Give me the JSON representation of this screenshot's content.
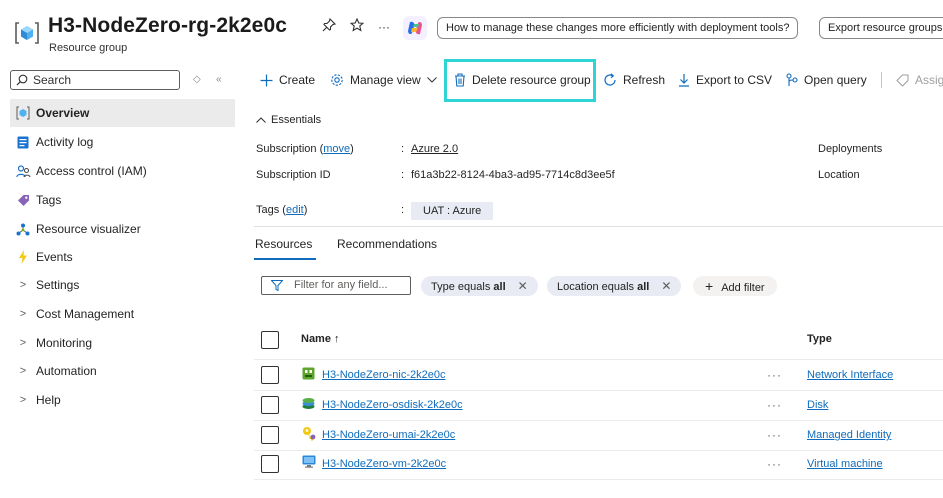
{
  "header": {
    "title": "H3-NodeZero-rg-2k2e0c",
    "subtitle": "Resource group",
    "more": "···",
    "suggestion_1": "How to manage these changes more efficiently with deployment tools?",
    "suggestion_2": "Export resource groups"
  },
  "sidebar": {
    "search_placeholder": "Search",
    "items": [
      {
        "label": "Overview",
        "icon": "resource-group-icon"
      },
      {
        "label": "Activity log",
        "icon": "activity-log-icon"
      },
      {
        "label": "Access control (IAM)",
        "icon": "people-icon"
      },
      {
        "label": "Tags",
        "icon": "tag-icon"
      },
      {
        "label": "Resource visualizer",
        "icon": "visualizer-icon"
      },
      {
        "label": "Events",
        "icon": "bolt-icon"
      },
      {
        "label": "Settings",
        "icon": "chevron-right-icon"
      },
      {
        "label": "Cost Management",
        "icon": "chevron-right-icon"
      },
      {
        "label": "Monitoring",
        "icon": "chevron-right-icon"
      },
      {
        "label": "Automation",
        "icon": "chevron-right-icon"
      },
      {
        "label": "Help",
        "icon": "chevron-right-icon"
      }
    ]
  },
  "toolbar": {
    "create": "Create",
    "manage_view": "Manage view",
    "delete": "Delete resource group",
    "refresh": "Refresh",
    "export_csv": "Export to CSV",
    "open_query": "Open query",
    "assign": "Assig"
  },
  "essentials": {
    "title": "Essentials",
    "subscription_label": "Subscription (",
    "subscription_link": "move",
    "subscription_close": ")",
    "subscription_value": "Azure 2.0",
    "subscription_id_label": "Subscription ID",
    "subscription_id_value": "f61a3b22-8124-4ba3-ad95-7714c8d3ee5f",
    "deployments_label": "Deployments",
    "location_label": "Location",
    "tags_label": "Tags (",
    "tags_link": "edit",
    "tags_close": ")",
    "tag_value": "UAT : Azure",
    "colon": ":"
  },
  "tabs": [
    {
      "label": "Resources",
      "active": true
    },
    {
      "label": "Recommendations",
      "active": false
    }
  ],
  "filters": {
    "placeholder": "Filter for any field...",
    "type_prefix": "Type equals",
    "type_value": "all",
    "location_prefix": "Location equals",
    "location_value": "all",
    "add_filter": "Add filter"
  },
  "table": {
    "col_name": "Name ↑",
    "col_type": "Type",
    "rows": [
      {
        "name": "H3-NodeZero-nic-2k2e0c",
        "type": "Network Interface",
        "icon": "network-interface-icon"
      },
      {
        "name": "H3-NodeZero-osdisk-2k2e0c",
        "type": "Disk",
        "icon": "disk-icon"
      },
      {
        "name": "H3-NodeZero-umai-2k2e0c",
        "type": "Managed Identity",
        "icon": "managed-identity-icon"
      },
      {
        "name": "H3-NodeZero-vm-2k2e0c",
        "type": "Virtual machine",
        "icon": "virtual-machine-icon"
      }
    ],
    "row_more": "···"
  },
  "colors": {
    "accent": "#0f6cbd",
    "highlight": "#2fd5d5"
  }
}
